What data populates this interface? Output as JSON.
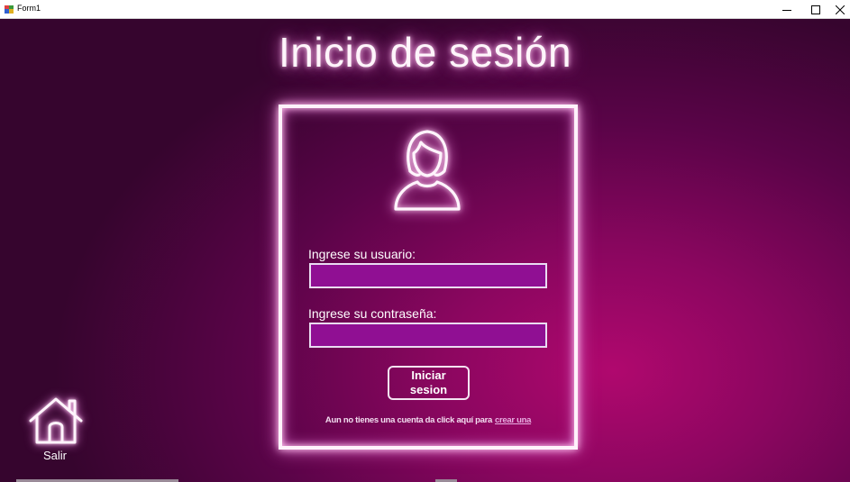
{
  "window": {
    "title": "Form1"
  },
  "page": {
    "heading": "Inicio de sesión"
  },
  "login": {
    "user_label": "Ingrese su usuario:",
    "user_value": "",
    "pass_label": "Ingrese su contraseña:",
    "pass_value": "",
    "submit_label": "Iniciar\nsesion",
    "footer_text": "Aun no tienes una cuenta  da click aquí para",
    "footer_link": "crear una"
  },
  "exit": {
    "label": "Salir",
    "icon": "home-icon"
  },
  "colors": {
    "accent": "#b0086e",
    "field_bg": "#900f93",
    "glow": "#e070c8"
  }
}
